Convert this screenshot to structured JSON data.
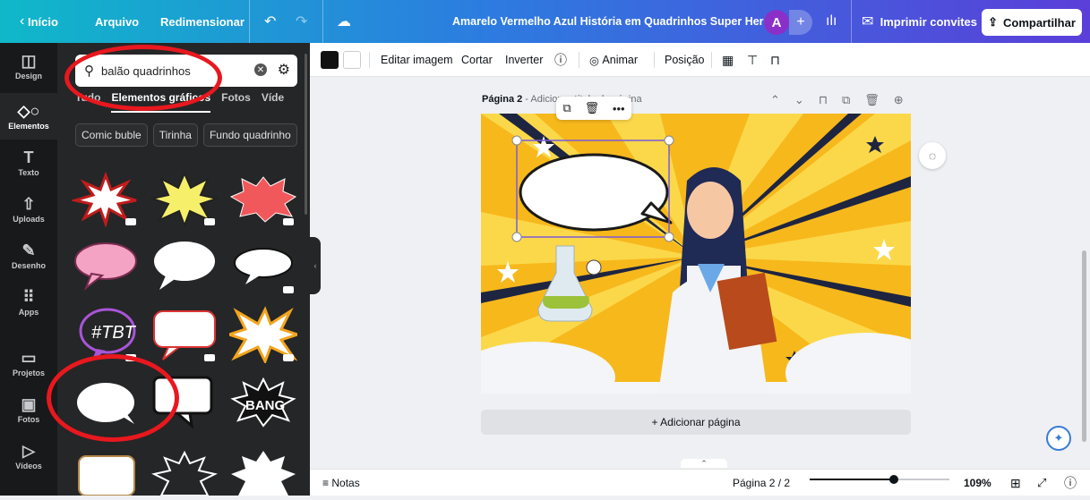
{
  "topbar": {
    "back_label": "Início",
    "file_label": "Arquivo",
    "resize_label": "Redimensionar",
    "doc_title": "Amarelo Vermelho Azul História em Quadrinhos Super Heró...",
    "avatar_letter": "A",
    "print_label": "Imprimir convites",
    "share_label": "Compartilhar"
  },
  "rail": {
    "items": [
      {
        "label": "Design",
        "icon": "layout-icon"
      },
      {
        "label": "Elementos",
        "icon": "shapes-icon"
      },
      {
        "label": "Texto",
        "icon": "text-icon"
      },
      {
        "label": "Uploads",
        "icon": "cloud-upload-icon"
      },
      {
        "label": "Desenho",
        "icon": "pen-icon"
      },
      {
        "label": "Apps",
        "icon": "grid-icon"
      },
      {
        "label": "Projetos",
        "icon": "folder-icon"
      },
      {
        "label": "Fotos",
        "icon": "photo-icon"
      },
      {
        "label": "Vídeos",
        "icon": "video-icon"
      }
    ]
  },
  "panel": {
    "search_value": "balão quadrinhos",
    "tabs": [
      "Tudo",
      "Elementos gráficos",
      "Fotos",
      "Víde"
    ],
    "chips": [
      "Comic buble",
      "Tirinha",
      "Fundo quadrinho"
    ],
    "bang_text": "BANG",
    "tbt_text": "#TBT"
  },
  "toolbar": {
    "edit_image": "Editar imagem",
    "crop": "Cortar",
    "flip": "Inverter",
    "animate": "Animar",
    "position": "Posição",
    "color_primary": "#111111",
    "color_secondary": "#ffffff"
  },
  "canvas": {
    "page_title": "Página 2",
    "page_title_suffix": " - Adicionar título de página",
    "add_page": "+ Adicionar página"
  },
  "bottombar": {
    "notes": "Notas",
    "page_indicator": "Página 2 / 2",
    "zoom": "109%",
    "zoom_fraction": 0.6
  },
  "colors": {
    "annotation": "#e8181e",
    "accent": "#5a3fd9",
    "background_yellow": "#f7b81c"
  }
}
